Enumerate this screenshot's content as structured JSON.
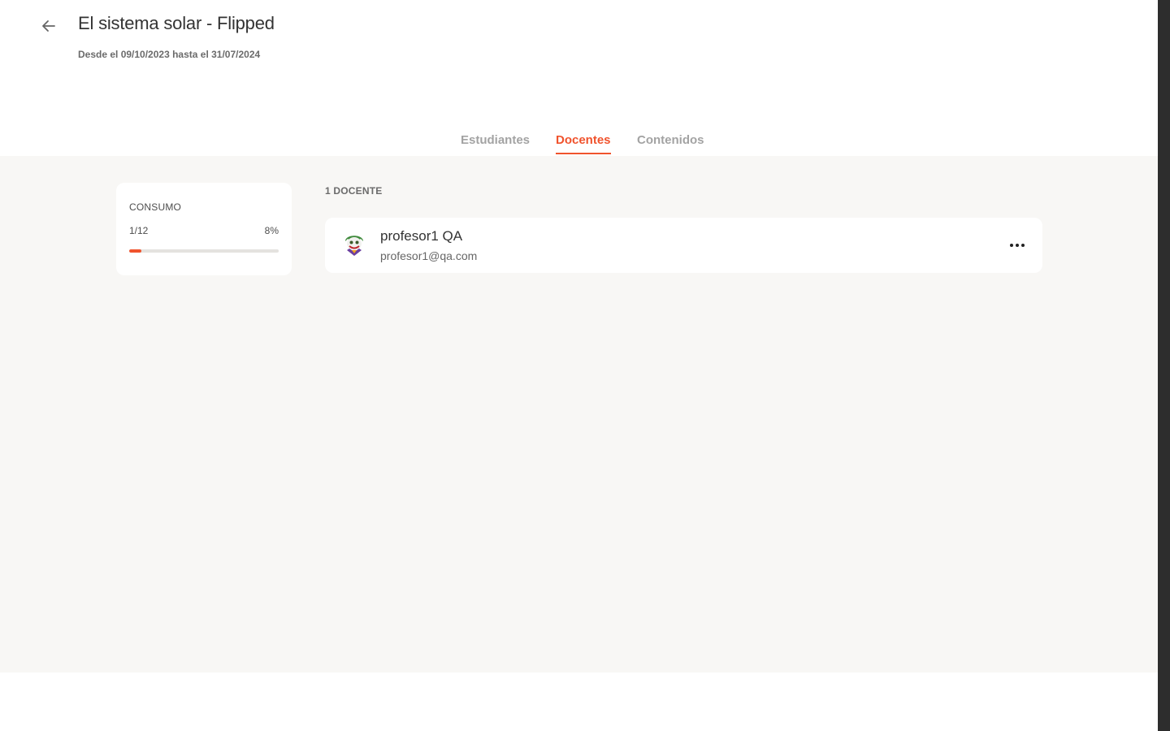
{
  "header": {
    "title": "El sistema solar - Flipped",
    "subtitle": "Desde el 09/10/2023 hasta el 31/07/2024",
    "back_icon": "arrow-left-icon"
  },
  "tabs": [
    {
      "label": "Estudiantes",
      "active": false
    },
    {
      "label": "Docentes",
      "active": true
    },
    {
      "label": "Contenidos",
      "active": false
    }
  ],
  "consumption": {
    "label": "CONSUMO",
    "count": "1/12",
    "percent": "8%",
    "progress_fraction": 0.08
  },
  "teachers": {
    "count_label": "1 DOCENTE",
    "items": [
      {
        "name": "profesor1 QA",
        "email": "profesor1@qa.com",
        "avatar_icon": "joker-avatar-icon",
        "menu_icon": "more-dots-icon"
      }
    ]
  },
  "colors": {
    "accent": "#f0532d",
    "content_background": "#f8f7f5",
    "side_bar": "#2d2d2d"
  }
}
